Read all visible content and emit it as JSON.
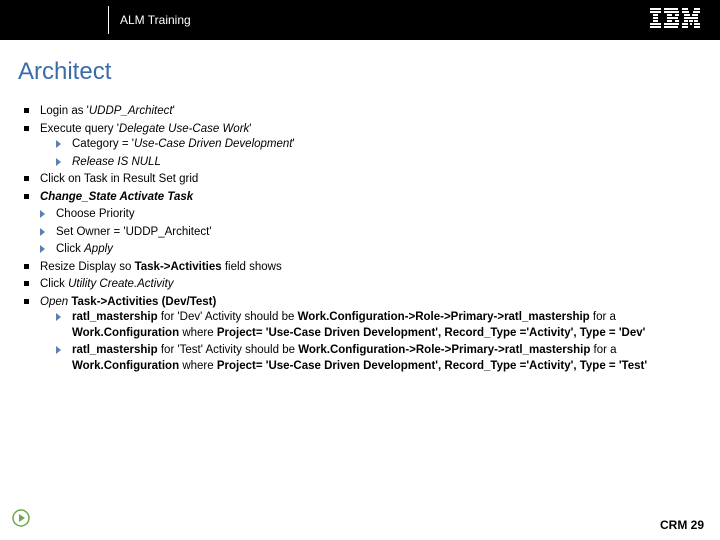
{
  "header": {
    "title": "ALM Training",
    "logo_alt": "IBM"
  },
  "slide": {
    "title": "Architect"
  },
  "bullets": {
    "b1_pre": "Login as '",
    "b1_em": "UDDP_Architect",
    "b1_post": "'",
    "b2_pre": "Execute query '",
    "b2_em": "Delegate Use-Case Work",
    "b2_post": "'",
    "b2a_pre": "Category = '",
    "b2a_em": "Use-Case Driven Development",
    "b2a_post": "'",
    "b2b": "Release IS NULL",
    "b3": "Click on Task in Result Set grid",
    "b4": "Change_State Activate Task",
    "b4a": "Choose Priority",
    "b4b": "Set Owner = 'UDDP_Architect'",
    "b4c_pre": "Click ",
    "b4c_em": "Apply",
    "b5_pre": "Resize Display so ",
    "b5_bold": "Task->Activities",
    "b5_post": " field shows",
    "b6_pre": "Click ",
    "b6_em": "Utility Create.Activity",
    "b7_em": "Open",
    "b7_bold": " Task->Activities (Dev/Test)",
    "b7a_pre": "ratl_mastership",
    "b7a_mid1": " for 'Dev' Activity should be ",
    "b7a_bold1": "Work.Configuration->Role->Primary->ratl_mastership",
    "b7a_mid2": " for a ",
    "b7a_bold2": "Work.Configuration",
    "b7a_mid3": " where ",
    "b7a_bold3": "Project= 'Use-Case Driven Development', Record_Type ='Activity', Type = 'Dev'",
    "b7b_pre": "ratl_mastership",
    "b7b_mid1": " for 'Test' Activity should be ",
    "b7b_bold1": "Work.Configuration->Role->Primary->ratl_mastership",
    "b7b_mid2": " for a ",
    "b7b_bold2": "Work.Configuration",
    "b7b_mid3": " where ",
    "b7b_bold3": "Project= 'Use-Case Driven Development', Record_Type ='Activity', Type = 'Test'"
  },
  "footer": {
    "label": "CRM 29"
  }
}
